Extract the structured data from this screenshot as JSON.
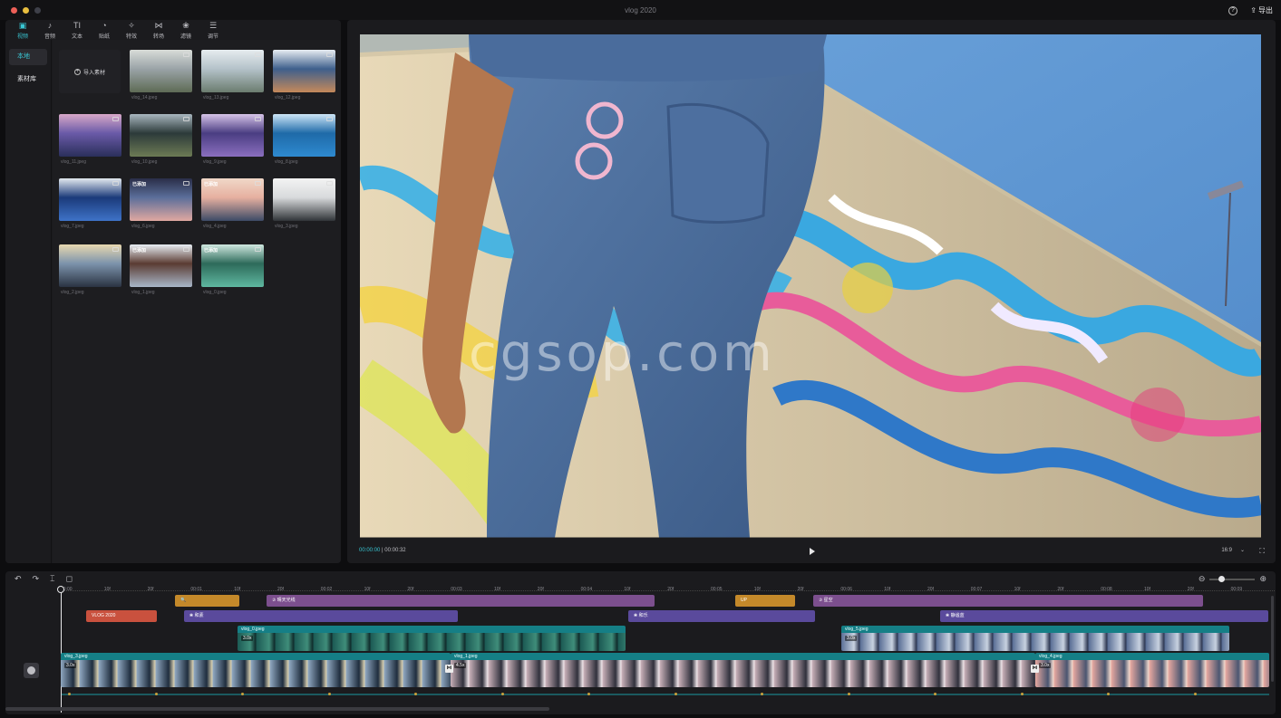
{
  "window": {
    "title": "vlog 2020",
    "export_label": "导出",
    "help_glyph": "?"
  },
  "toolbar": [
    {
      "label": "视频",
      "icon": "video-icon",
      "glyph": "▣",
      "active": true
    },
    {
      "label": "音频",
      "icon": "audio-icon",
      "glyph": "♪"
    },
    {
      "label": "文本",
      "icon": "text-icon",
      "glyph": "TI"
    },
    {
      "label": "贴纸",
      "icon": "sticker-icon",
      "glyph": "◔"
    },
    {
      "label": "特效",
      "icon": "effects-icon",
      "glyph": "✧"
    },
    {
      "label": "转场",
      "icon": "transition-icon",
      "glyph": "⋈"
    },
    {
      "label": "滤镜",
      "icon": "filter-icon",
      "glyph": "❀"
    },
    {
      "label": "调节",
      "icon": "adjust-icon",
      "glyph": "☰"
    }
  ],
  "sidebar": {
    "local": "本地",
    "library": "素材库"
  },
  "media": {
    "import_label": "导入素材",
    "items": [
      {
        "name": "vlog_14.jpeg"
      },
      {
        "name": "vlog_13.jpeg"
      },
      {
        "name": "vlog_12.jpeg"
      },
      {
        "name": "vlog_11.jpeg"
      },
      {
        "name": "vlog_10.jpeg"
      },
      {
        "name": "vlog_9.jpeg"
      },
      {
        "name": "vlog_8.jpeg"
      },
      {
        "name": "vlog_7.jpeg"
      },
      {
        "name": "vlog_6.jpeg",
        "tag": "已添加"
      },
      {
        "name": "vlog_4.jpeg",
        "tag": "已添加"
      },
      {
        "name": "vlog_3.jpeg"
      },
      {
        "name": "vlog_2.jpeg"
      },
      {
        "name": "vlog_1.jpeg",
        "tag": "已添加"
      },
      {
        "name": "vlog_0.jpeg",
        "tag": "已添加"
      }
    ]
  },
  "preview": {
    "watermark": "cgsop.com",
    "current_time": "00:00:00",
    "total_time": "00:00:32",
    "ratio": "16:9",
    "ratio_arrow": "⌄",
    "fullscreen_glyph": "⛶"
  },
  "timeline": {
    "tools": [
      "↶",
      "↷",
      "⌶",
      "◻"
    ],
    "zoom_out": "⊖",
    "zoom_in": "⊕",
    "zoom_level": 0.2,
    "ruler": [
      "00:00",
      "10f",
      "20f",
      "00:01",
      "10f",
      "20f",
      "00:02",
      "10f",
      "20f",
      "00:03",
      "10f",
      "20f",
      "00:04",
      "10f",
      "20f",
      "00:05",
      "10f",
      "20f",
      "00:06",
      "10f",
      "20f",
      "00:07",
      "10f",
      "20f",
      "00:08",
      "10f",
      "20f",
      "00:09"
    ],
    "effect_clips": [
      {
        "label": "🔍",
        "color": "#c4892a"
      },
      {
        "label": "✰ 晴天光线",
        "color": "#7c4f8e"
      },
      {
        "label": "UP",
        "color": "#c4892a"
      },
      {
        "label": "✰ 星空",
        "color": "#7c4f8e"
      }
    ],
    "text_clips": [
      {
        "label": "VLOG 2020",
        "color": "#c9513e"
      },
      {
        "label": "❀ 和素",
        "color": "#5a4a9c"
      },
      {
        "label": "❀ 和乐",
        "color": "#5a4a9c"
      },
      {
        "label": "❀ 静谧蓝",
        "color": "#5a4a9c"
      }
    ],
    "overlay_clips": [
      {
        "name": "vlog_0.jpeg",
        "speed": "3.0x"
      },
      {
        "name": "vlog_5.jpeg",
        "speed": "3.0x"
      }
    ],
    "main_clips": [
      {
        "name": "vlog_3.jpeg",
        "speed": "3.0x"
      },
      {
        "name": "vlog_1.jpeg",
        "speed": "4.5x"
      },
      {
        "name": "vlog_4.jpeg",
        "speed": "3.0x"
      }
    ]
  }
}
